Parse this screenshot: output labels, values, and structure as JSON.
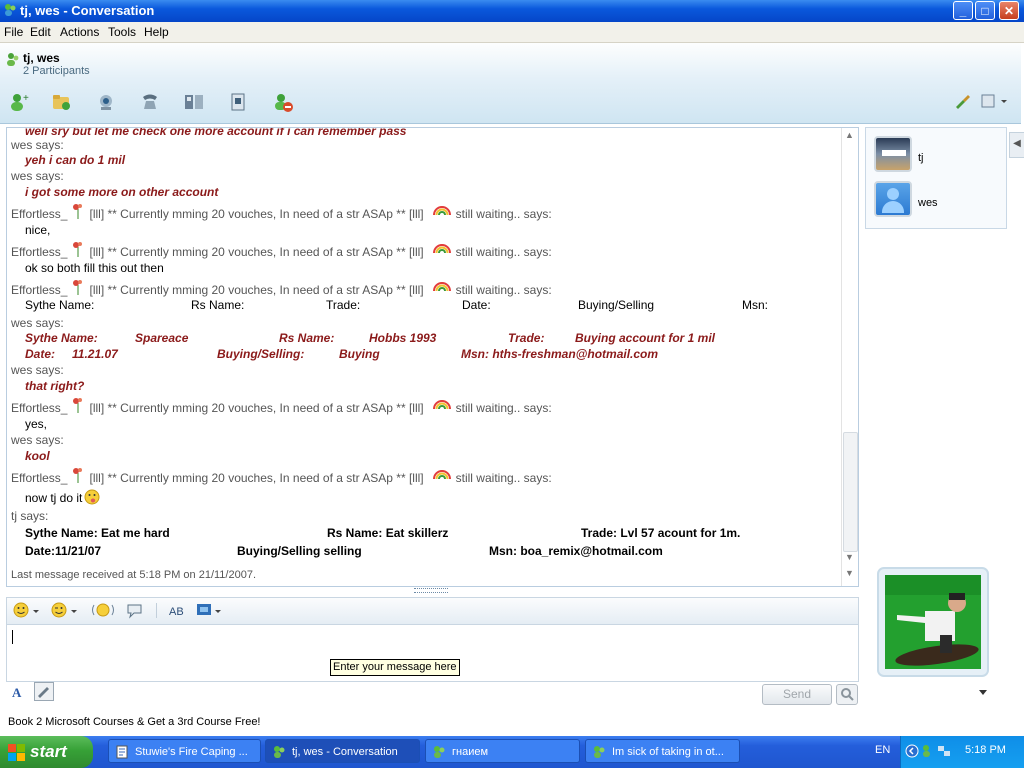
{
  "window": {
    "title": "tj, wes - Conversation"
  },
  "menu": [
    "File",
    "Edit",
    "Actions",
    "Tools",
    "Help"
  ],
  "header": {
    "name": "tj, wes",
    "participants": "2 Participants"
  },
  "toolbar_icons": [
    "invite-contact-icon",
    "share-folder-icon",
    "webcam-call-icon",
    "phone-call-icon",
    "video-call-icon",
    "activities-icon",
    "block-icon"
  ],
  "conversation": {
    "lines": [
      {
        "kind": "bold-red",
        "text": "well sry but let me check one more account if i can remember pass"
      },
      {
        "kind": "says",
        "text": "wes says:"
      },
      {
        "kind": "bold-red",
        "text": "yeh i can do 1 mil"
      },
      {
        "kind": "says",
        "text": "wes says:"
      },
      {
        "kind": "bold-red",
        "text": "i got some more on other account"
      },
      {
        "kind": "effortless",
        "prefix": "Effortless_",
        "text": "[lll] ** Currently mming 20 vouches, In need of a str ASAp ** [lll]",
        "suffix": "still waiting.. says:"
      },
      {
        "kind": "plain",
        "text": "nice,"
      },
      {
        "kind": "effortless",
        "prefix": "Effortless_",
        "text": "[lll] ** Currently mming 20 vouches, In need of a str ASAp ** [lll]",
        "suffix": "still waiting.. says:"
      },
      {
        "kind": "plain",
        "text": "ok so both fill this out then"
      },
      {
        "kind": "effortless",
        "prefix": "Effortless_",
        "text": "[lll] ** Currently mming 20 vouches, In need of a str ASAp ** [lll]",
        "suffix": "still waiting.. says:"
      },
      {
        "kind": "form",
        "fields": [
          "Sythe Name:",
          "Rs Name:",
          "Trade:",
          "Date:",
          "Buying/Selling",
          "Msn:"
        ]
      },
      {
        "kind": "says",
        "text": "wes says:"
      },
      {
        "kind": "bold-red-row",
        "cells": [
          "Sythe Name:",
          "Spareace",
          "Rs Name:",
          "Hobbs 1993",
          "Trade:",
          "Buying account for 1 mil"
        ]
      },
      {
        "kind": "bold-red-row",
        "cells": [
          "Date:",
          "11.21.07",
          "Buying/Selling:",
          "Buying",
          "Msn: hths-freshman@hotmail.com"
        ]
      },
      {
        "kind": "says",
        "text": "wes says:"
      },
      {
        "kind": "bold-red",
        "text": "that right?"
      },
      {
        "kind": "effortless",
        "prefix": "Effortless_",
        "text": "[lll] ** Currently mming 20 vouches, In need of a str ASAp ** [lll]",
        "suffix": "still waiting.. says:"
      },
      {
        "kind": "plain",
        "text": "yes,"
      },
      {
        "kind": "says",
        "text": "wes says:"
      },
      {
        "kind": "bold-red",
        "text": "kool"
      },
      {
        "kind": "effortless",
        "prefix": "Effortless_",
        "text": "[lll] ** Currently mming 20 vouches, In need of a str ASAp ** [lll]",
        "suffix": "still waiting.. says:"
      },
      {
        "kind": "plain",
        "text": "now tj do it"
      },
      {
        "kind": "says",
        "text": "tj says:"
      },
      {
        "kind": "tj-row",
        "cells": [
          "Sythe Name:  Eat me hard",
          "Rs Name:  Eat skillerz",
          "Trade: Lvl 57 acount for 1m."
        ]
      },
      {
        "kind": "tj-row",
        "cells": [
          "Date:11/21/07",
          "Buying/Selling selling",
          "Msn: boa_remix@hotmail.com"
        ]
      }
    ],
    "last_received": "Last message received at 5:18 PM on 21/11/2007."
  },
  "participants": [
    {
      "name": "tj",
      "icon": "tj-avatar-icon"
    },
    {
      "name": "wes",
      "icon": "wes-avatar-icon"
    }
  ],
  "compose": {
    "tooltip": "Enter your message here",
    "send_label": "Send"
  },
  "ad": "Book 2 Microsoft Courses & Get a 3rd Course Free!",
  "taskbar": {
    "start": "start",
    "tasks": [
      "Stuwie's Fire Caping ...",
      "tj, wes - Conversation",
      "гнаием",
      "Im sick of taking in ot..."
    ],
    "lang": "EN",
    "clock": "5:18 PM"
  },
  "colors": {
    "accent": "#0a58dc",
    "wes_text": "#8b1a1a",
    "taskbar": "#245edb",
    "start": "#37a137"
  }
}
